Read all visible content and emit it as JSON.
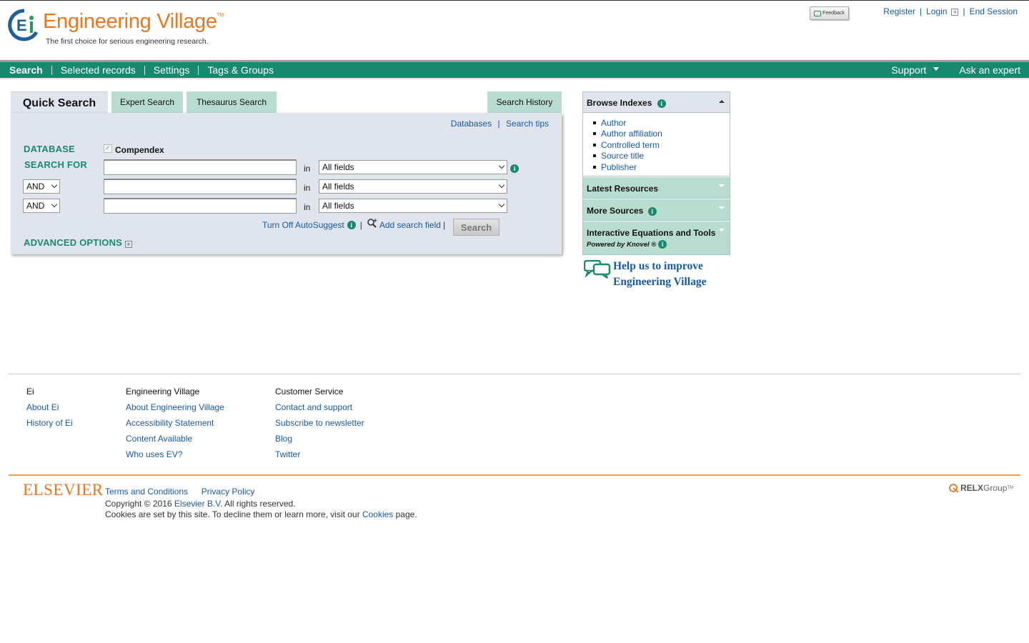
{
  "header": {
    "logo_title": "Engineering Village",
    "logo_tm": "TM",
    "tagline": "The first choice for serious engineering research.",
    "feedback_label": "Feedback",
    "links": {
      "register": "Register",
      "login": "Login",
      "end_session": "End Session"
    }
  },
  "nav": {
    "items": [
      "Search",
      "Selected records",
      "Settings",
      "Tags & Groups"
    ],
    "support": "Support",
    "ask_expert": "Ask an expert"
  },
  "tabs": {
    "quick": "Quick Search",
    "expert": "Expert Search",
    "thesaurus": "Thesaurus Search",
    "history": "Search History"
  },
  "search": {
    "databases_link": "Databases",
    "tips_link": "Search tips",
    "database_label": "DATABASE",
    "database_value": "Compendex",
    "search_for_label": "SEARCH FOR",
    "in_label": "in",
    "field_options": [
      "All fields",
      "All fields",
      "All fields"
    ],
    "operators": [
      "AND",
      "AND"
    ],
    "autosuggest": "Turn Off AutoSuggest",
    "add_field": "Add search field",
    "search_button": "Search",
    "advanced": "ADVANCED OPTIONS"
  },
  "sidebar": {
    "browse_title": "Browse Indexes",
    "browse_items": [
      "Author",
      "Author affiliation",
      "Controlled term",
      "Source title",
      "Publisher"
    ],
    "latest": "Latest Resources",
    "more_sources": "More Sources",
    "interactive": "Interactive Equations and Tools",
    "powered": "Powered by Knovel ®",
    "help_line1": "Help us to improve",
    "help_line2": "Engineering Village"
  },
  "footer": {
    "col1": {
      "heading": "Ei",
      "links": [
        "About Ei",
        "History of Ei"
      ]
    },
    "col2": {
      "heading": "Engineering Village",
      "links": [
        "About Engineering Village",
        "Accessibility Statement",
        "Content Available",
        "Who uses EV?"
      ]
    },
    "col3": {
      "heading": "Customer Service",
      "links": [
        "Contact and support",
        "Subscribe to newsletter",
        "Blog",
        "Twitter"
      ]
    },
    "elsevier": "ELSEVIER",
    "terms": "Terms and Conditions",
    "privacy": "Privacy Policy",
    "copyright_pre": "Copyright © 2016 ",
    "copyright_link": "Elsevier B.V.",
    "copyright_post": " All rights reserved.",
    "cookies_pre": "Cookies are set by this site. To decline them or learn more, visit our ",
    "cookies_link": "Cookies",
    "cookies_post": " page.",
    "relx": "RELX",
    "relx_group": "Group",
    "relx_tm": "TM"
  },
  "colors": {
    "brand_green": "#17896f",
    "brand_orange": "#e87722",
    "link_blue": "#1a5aa6",
    "tab_green": "#b8dccf",
    "panel_bg": "#e0e4ec"
  }
}
